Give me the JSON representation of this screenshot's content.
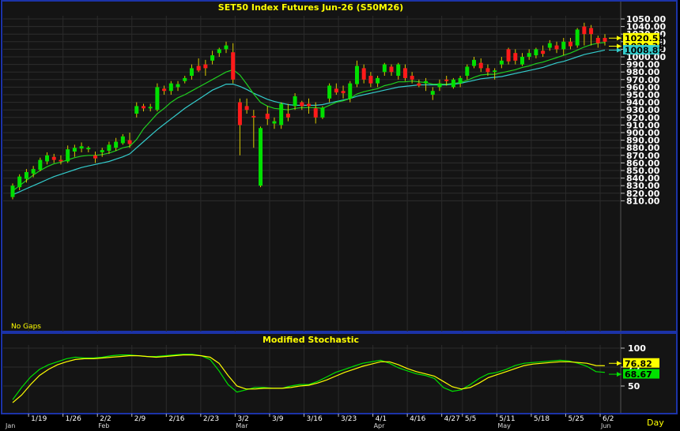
{
  "chart_data": [
    {
      "type": "candlestick",
      "title": "SET50  Index  Futures  Jun-26  (S50M26)",
      "note": "No  Gaps",
      "y_ticks": [
        "810.00",
        "820.00",
        "830.00",
        "840.00",
        "850.00",
        "860.00",
        "870.00",
        "880.00",
        "890.00",
        "900.00",
        "910.00",
        "920.00",
        "930.00",
        "940.00",
        "950.00",
        "960.00",
        "970.00",
        "980.00",
        "990.00",
        "1000.00",
        "1010.00",
        "1020.00",
        "1030.00",
        "1040.00",
        "1050.00"
      ],
      "ylim": [
        803,
        1057
      ],
      "colors": {
        "up": "#00e000",
        "down": "#ff1a1a",
        "ma_fast": "#1fcf1f",
        "ma_slow": "#33cccc"
      },
      "price_tags": [
        {
          "label": "1020.53",
          "value": 1020.53,
          "color": "#ffff00"
        },
        {
          "label": "1020.30",
          "value": 1020.3,
          "color": "#ffff00"
        },
        {
          "label": "1008.82",
          "value": 1008.82,
          "color": "#33cccc"
        }
      ],
      "candles": [
        [
          815,
          833,
          812,
          830
        ],
        [
          828,
          845,
          824,
          842
        ],
        [
          839,
          852,
          834,
          848
        ],
        [
          846,
          856,
          841,
          852
        ],
        [
          851,
          867,
          849,
          864
        ],
        [
          862,
          874,
          858,
          870
        ],
        [
          868,
          872,
          860,
          864
        ],
        [
          864,
          870,
          858,
          862
        ],
        [
          862,
          883,
          860,
          878
        ],
        [
          875,
          884,
          868,
          880
        ],
        [
          879,
          887,
          874,
          882
        ],
        [
          878,
          882,
          874,
          880
        ],
        [
          870,
          875,
          860,
          866
        ],
        [
          874,
          880,
          868,
          877
        ],
        [
          876,
          888,
          872,
          884
        ],
        [
          880,
          893,
          876,
          888
        ],
        [
          886,
          898,
          884,
          895
        ],
        [
          890,
          900,
          880,
          885
        ],
        [
          925,
          940,
          920,
          935
        ],
        [
          935,
          938,
          928,
          932
        ],
        [
          932,
          938,
          928,
          934
        ],
        [
          930,
          965,
          928,
          960
        ],
        [
          958,
          962,
          950,
          955
        ],
        [
          955,
          968,
          950,
          965
        ],
        [
          960,
          968,
          955,
          964
        ],
        [
          968,
          975,
          965,
          972
        ],
        [
          975,
          990,
          970,
          985
        ],
        [
          988,
          998,
          980,
          982
        ],
        [
          990,
          996,
          975,
          985
        ],
        [
          995,
          1008,
          990,
          1002
        ],
        [
          1005,
          1012,
          1000,
          1010
        ],
        [
          1010,
          1020,
          1005,
          1015
        ],
        [
          1006,
          1018,
          965,
          970
        ],
        [
          940,
          945,
          870,
          910
        ],
        [
          935,
          945,
          925,
          930
        ],
        [
          922,
          930,
          880,
          920
        ],
        [
          830,
          908,
          828,
          906
        ],
        [
          925,
          935,
          910,
          918
        ],
        [
          912,
          920,
          905,
          915
        ],
        [
          910,
          940,
          905,
          938
        ],
        [
          925,
          938,
          915,
          920
        ],
        [
          935,
          952,
          930,
          948
        ],
        [
          940,
          942,
          930,
          935
        ],
        [
          938,
          945,
          925,
          935
        ],
        [
          932,
          940,
          912,
          920
        ],
        [
          920,
          935,
          918,
          933
        ],
        [
          945,
          965,
          940,
          962
        ],
        [
          958,
          965,
          950,
          953
        ],
        [
          955,
          962,
          945,
          952
        ],
        [
          945,
          968,
          940,
          965
        ],
        [
          964,
          995,
          960,
          988
        ],
        [
          985,
          990,
          965,
          970
        ],
        [
          975,
          980,
          960,
          965
        ],
        [
          965,
          975,
          960,
          972
        ],
        [
          980,
          992,
          975,
          990
        ],
        [
          987,
          990,
          975,
          980
        ],
        [
          975,
          992,
          970,
          990
        ],
        [
          985,
          990,
          968,
          972
        ],
        [
          975,
          980,
          965,
          970
        ],
        [
          965,
          970,
          960,
          962
        ],
        [
          965,
          972,
          955,
          968
        ],
        [
          950,
          960,
          943,
          955
        ],
        [
          960,
          970,
          955,
          965
        ],
        [
          970,
          975,
          962,
          968
        ],
        [
          960,
          972,
          958,
          970
        ],
        [
          965,
          975,
          960,
          972
        ],
        [
          975,
          990,
          970,
          987
        ],
        [
          988,
          1000,
          985,
          996
        ],
        [
          992,
          998,
          980,
          985
        ],
        [
          985,
          990,
          975,
          980
        ],
        [
          980,
          985,
          970,
          982
        ],
        [
          990,
          1000,
          985,
          995
        ],
        [
          1010,
          1012,
          990,
          994
        ],
        [
          1005,
          1010,
          990,
          995
        ],
        [
          990,
          1005,
          988,
          1000
        ],
        [
          1000,
          1010,
          996,
          1005
        ],
        [
          1002,
          1012,
          998,
          1010
        ],
        [
          1008,
          1015,
          1000,
          1004
        ],
        [
          1012,
          1022,
          1008,
          1018
        ],
        [
          1015,
          1020,
          1005,
          1010
        ],
        [
          1010,
          1025,
          1002,
          1020
        ],
        [
          1020,
          1025,
          1010,
          1014
        ],
        [
          1015,
          1038,
          1012,
          1036
        ],
        [
          1040,
          1045,
          1015,
          1030
        ],
        [
          1038,
          1042,
          1015,
          1030
        ],
        [
          1025,
          1028,
          1012,
          1018
        ],
        [
          1025,
          1030,
          1015,
          1020
        ]
      ],
      "ma_fast": [
        823,
        830,
        837,
        844,
        850,
        855,
        859,
        861,
        864,
        867,
        869,
        870,
        870,
        871,
        873,
        876,
        880,
        882,
        891,
        905,
        915,
        925,
        932,
        940,
        946,
        950,
        955,
        960,
        965,
        970,
        975,
        980,
        983,
        976,
        964,
        951,
        940,
        935,
        932,
        931,
        930,
        932,
        933,
        933,
        933,
        932,
        936,
        940,
        942,
        945,
        951,
        954,
        956,
        958,
        962,
        964,
        967,
        967,
        968,
        967,
        966,
        964,
        964,
        964,
        965,
        966,
        969,
        973,
        976,
        977,
        977,
        979,
        981,
        983,
        986,
        988,
        991,
        993,
        996,
        999,
        1002,
        1005,
        1009,
        1013,
        1016,
        1018,
        1019
      ],
      "ma_slow": [
        818,
        822,
        826,
        830,
        834,
        838,
        842,
        845,
        848,
        851,
        854,
        856,
        858,
        860,
        862,
        865,
        868,
        872,
        880,
        888,
        896,
        904,
        911,
        918,
        925,
        932,
        938,
        944,
        950,
        956,
        960,
        964,
        964,
        961,
        957,
        952,
        948,
        944,
        941,
        939,
        937,
        936,
        936,
        936,
        936,
        937,
        939,
        941,
        943,
        945,
        948,
        950,
        952,
        954,
        956,
        958,
        960,
        961,
        962,
        963,
        963,
        963,
        963,
        963,
        964,
        965,
        967,
        969,
        971,
        972,
        973,
        974,
        976,
        978,
        980,
        982,
        984,
        986,
        989,
        992,
        994,
        997,
        1000,
        1003,
        1005,
        1007,
        1009
      ]
    },
    {
      "type": "line",
      "title": "Modified  Stochastic",
      "y_ticks": [
        "50",
        "75",
        "100"
      ],
      "ylim": [
        20,
        110
      ],
      "price_tags": [
        {
          "label": "76.82",
          "value": 76.82,
          "color": "#ffff00"
        },
        {
          "label": "68.67",
          "value": 68.67,
          "color": "#00e000"
        }
      ],
      "series": [
        {
          "color": "#00e000",
          "values": [
            32,
            48,
            62,
            72,
            78,
            82,
            86,
            88,
            87,
            87,
            88,
            90,
            91,
            91,
            90,
            89,
            89,
            90,
            91,
            92,
            92,
            90,
            85,
            70,
            52,
            42,
            45,
            48,
            48,
            47,
            47,
            50,
            52,
            52,
            56,
            62,
            68,
            72,
            76,
            80,
            82,
            84,
            80,
            74,
            70,
            66,
            64,
            60,
            48,
            43,
            45,
            52,
            60,
            66,
            68,
            72,
            77,
            80,
            81,
            82,
            83,
            84,
            83,
            80,
            76,
            69,
            68
          ]
        },
        {
          "color": "#ffff00",
          "values": [
            28,
            38,
            52,
            64,
            72,
            78,
            82,
            85,
            86,
            86,
            87,
            88,
            89,
            90,
            90,
            89,
            88,
            89,
            90,
            91,
            91,
            90,
            88,
            80,
            64,
            50,
            46,
            46,
            47,
            47,
            47,
            48,
            50,
            51,
            54,
            58,
            63,
            68,
            72,
            76,
            79,
            82,
            82,
            78,
            73,
            69,
            66,
            63,
            56,
            49,
            46,
            48,
            54,
            61,
            65,
            69,
            73,
            77,
            79,
            80,
            81,
            82,
            82,
            81,
            80,
            77,
            76.82
          ]
        }
      ]
    }
  ],
  "x_axis": {
    "date_labels": [
      "1/19",
      "1/26",
      "2/2",
      "2/9",
      "2/16",
      "2/23",
      "3/2",
      "3/9",
      "3/16",
      "3/23",
      "4/1",
      "4/16",
      "4/27",
      "5/5",
      "5/11",
      "5/18",
      "5/25",
      "6/2"
    ],
    "month_labels": [
      "Jan",
      "Feb",
      "Mar",
      "Apr",
      "May",
      "Jun"
    ],
    "corner_label": "Day"
  }
}
